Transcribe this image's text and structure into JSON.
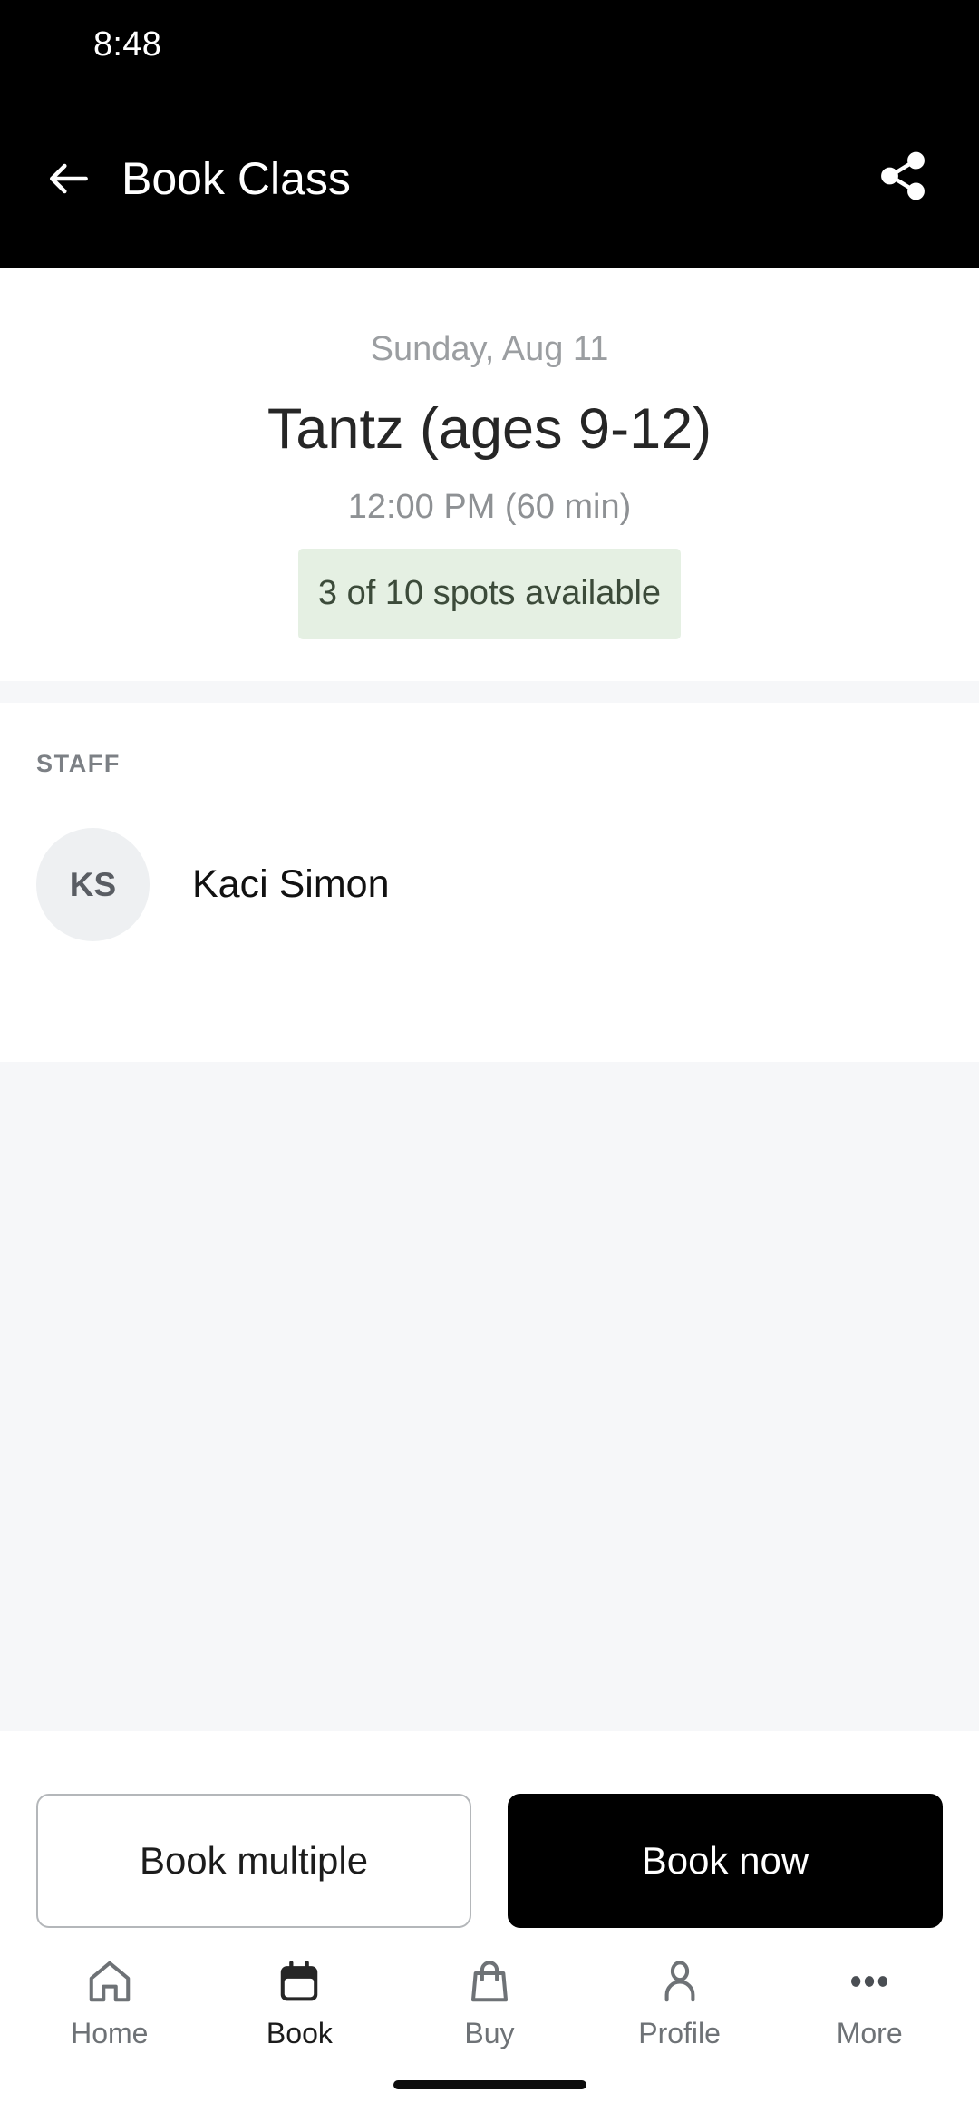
{
  "status_bar": {
    "time": "8:48"
  },
  "app_bar": {
    "title": "Book Class",
    "back_icon": "arrow-left-icon",
    "share_icon": "share-icon"
  },
  "class_info": {
    "date": "Sunday, Aug 11",
    "name": "Tantz (ages 9-12)",
    "time": "12:00 PM (60 min)",
    "spots_text": "3 of 10 spots available",
    "spots_available": 3,
    "spots_total": 10,
    "spots_bg_color": "#e5f0e3",
    "spots_text_color": "#3c4b3a"
  },
  "staff": {
    "section_label": "STAFF",
    "members": [
      {
        "initials": "KS",
        "name": "Kaci Simon"
      }
    ]
  },
  "actions": {
    "secondary_label": "Book multiple",
    "primary_label": "Book now"
  },
  "bottom_nav": {
    "items": [
      {
        "label": "Home",
        "icon": "home-icon",
        "active": false
      },
      {
        "label": "Book",
        "icon": "calendar-icon",
        "active": true
      },
      {
        "label": "Buy",
        "icon": "bag-icon",
        "active": false
      },
      {
        "label": "Profile",
        "icon": "person-icon",
        "active": false
      },
      {
        "label": "More",
        "icon": "ellipsis-icon",
        "active": false
      }
    ]
  }
}
